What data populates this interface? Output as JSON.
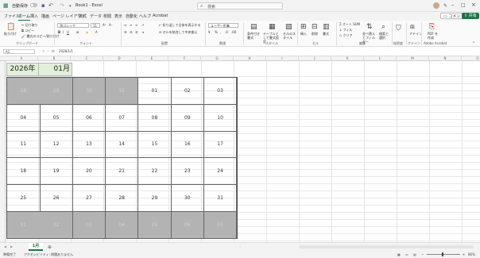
{
  "titlebar": {
    "autosave_label": "自動保存",
    "autosave_state": "オフ",
    "doc_title": "Book1 - Excel",
    "search_placeholder": "検索"
  },
  "tabs": [
    "ファイル",
    "ホーム",
    "挿入",
    "描画",
    "ページ レイアウト",
    "数式",
    "データ",
    "校閲",
    "表示",
    "自動化",
    "ヘルプ",
    "Acrobat"
  ],
  "tab_actions": {
    "comment_label": "コメント",
    "share_label": "共有"
  },
  "ribbon": {
    "clipboard": {
      "paste": "貼り付け",
      "cut": "切り取り",
      "copy": "コピー",
      "format_painter": "書式のコピー/貼り付け",
      "group": "クリップボード"
    },
    "font": {
      "name": "游ゴシック",
      "size": "11",
      "group": "フォント"
    },
    "alignment": {
      "wrap": "折り返して全体を表示する",
      "merge": "セルを結合して中央揃え",
      "group": "配置"
    },
    "number": {
      "format": "ユーザー定義",
      "group": "数値"
    },
    "styles": {
      "conditional": "条件付き書式",
      "table": "テーブルとして書式設定",
      "cell_styles": "セルのスタイル",
      "group": "スタイル"
    },
    "cells": {
      "insert": "挿入",
      "delete": "削除",
      "format": "書式",
      "group": "セル"
    },
    "editing": {
      "autosum": "オート SUM",
      "fill": "フィル",
      "clear": "クリア",
      "sort": "並べ替えとフィルター",
      "find": "検索と選択",
      "group": "編集"
    },
    "sensitivity": {
      "group": "秘密度"
    },
    "addins": {
      "label": "アドイン",
      "group": "アドイン"
    },
    "acrobat": {
      "label": "PDF を作成",
      "group": "Adobe Acrobat"
    }
  },
  "formula_bar": {
    "name_box": "A1",
    "fx": "fx",
    "formula": "2026/1/1"
  },
  "columns": [
    "A",
    "B",
    "C",
    "D",
    "E",
    "F",
    "G",
    "H",
    "I",
    "J",
    "K",
    "L",
    "M",
    "N",
    "O"
  ],
  "calendar": {
    "year": "2026年",
    "month": "01月",
    "weeks": [
      [
        {
          "d": "28",
          "dim": true
        },
        {
          "d": "29",
          "dim": true
        },
        {
          "d": "30",
          "dim": true
        },
        {
          "d": "31",
          "dim": true
        },
        {
          "d": "01",
          "dim": false
        },
        {
          "d": "02",
          "dim": false
        },
        {
          "d": "03",
          "dim": false
        }
      ],
      [
        {
          "d": "04",
          "dim": false
        },
        {
          "d": "05",
          "dim": false
        },
        {
          "d": "06",
          "dim": false
        },
        {
          "d": "07",
          "dim": false
        },
        {
          "d": "08",
          "dim": false
        },
        {
          "d": "09",
          "dim": false
        },
        {
          "d": "10",
          "dim": false
        }
      ],
      [
        {
          "d": "11",
          "dim": false
        },
        {
          "d": "12",
          "dim": false
        },
        {
          "d": "13",
          "dim": false
        },
        {
          "d": "14",
          "dim": false
        },
        {
          "d": "15",
          "dim": false
        },
        {
          "d": "16",
          "dim": false
        },
        {
          "d": "17",
          "dim": false
        }
      ],
      [
        {
          "d": "18",
          "dim": false
        },
        {
          "d": "19",
          "dim": false
        },
        {
          "d": "20",
          "dim": false
        },
        {
          "d": "21",
          "dim": false
        },
        {
          "d": "22",
          "dim": false
        },
        {
          "d": "23",
          "dim": false
        },
        {
          "d": "24",
          "dim": false
        }
      ],
      [
        {
          "d": "25",
          "dim": false
        },
        {
          "d": "26",
          "dim": false
        },
        {
          "d": "27",
          "dim": false
        },
        {
          "d": "28",
          "dim": false
        },
        {
          "d": "29",
          "dim": false
        },
        {
          "d": "30",
          "dim": false
        },
        {
          "d": "31",
          "dim": false
        }
      ],
      [
        {
          "d": "01",
          "dim": true
        },
        {
          "d": "02",
          "dim": true
        },
        {
          "d": "03",
          "dim": true
        },
        {
          "d": "04",
          "dim": true
        },
        {
          "d": "05",
          "dim": true
        },
        {
          "d": "06",
          "dim": true
        },
        {
          "d": "07",
          "dim": true
        }
      ]
    ]
  },
  "sheets": [
    "1月"
  ],
  "status": {
    "ready": "準備完了",
    "accessibility": "アクセシビリティ: 問題ありません",
    "zoom": "86%"
  },
  "colors": {
    "accent": "#1f7244",
    "header_fill": "#e2efda",
    "dim_fill": "#b3b3b3"
  }
}
